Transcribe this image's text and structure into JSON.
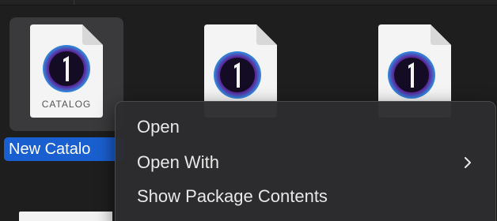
{
  "files": [
    {
      "name": "New Catalog",
      "caption": "CATALOG",
      "selected": true,
      "icon": "capture-one-catalog-icon"
    },
    {
      "name": "",
      "caption": "",
      "selected": false,
      "icon": "capture-one-document-icon"
    },
    {
      "name": "",
      "caption": "",
      "selected": false,
      "icon": "capture-one-document-icon"
    }
  ],
  "selection_label": "New Catalo",
  "context_menu": {
    "items": [
      {
        "label": "Open",
        "has_submenu": false
      },
      {
        "label": "Open With",
        "has_submenu": true
      },
      {
        "label": "Show Package Contents",
        "has_submenu": false
      }
    ]
  },
  "colors": {
    "selection_blue": "#1a5fd0",
    "menu_bg": "#2c2c2e",
    "window_bg": "#1e1e1e"
  }
}
